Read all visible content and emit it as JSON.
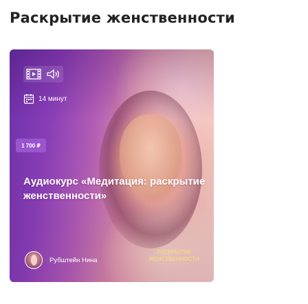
{
  "page": {
    "title": "Раскрытие женственности"
  },
  "card": {
    "media_icons": [
      "media-player-icon",
      "speaker-icon"
    ],
    "duration_icon": "calendar-icon",
    "duration": "14 минут",
    "price": "1 700 ₽",
    "title": "Аудиокурс «Медитация: раскрытие женственности»",
    "author_name": "Рубштейн Нина",
    "brand_mark": "РАСКРЫТИЕ ЖЕНСТВЕННОСТИ"
  },
  "colors": {
    "price_badge": "#9b55cf",
    "brand_mark": "#f3d48a",
    "gradient_start": "#6b2fa8",
    "gradient_end": "#f7cfc2"
  }
}
